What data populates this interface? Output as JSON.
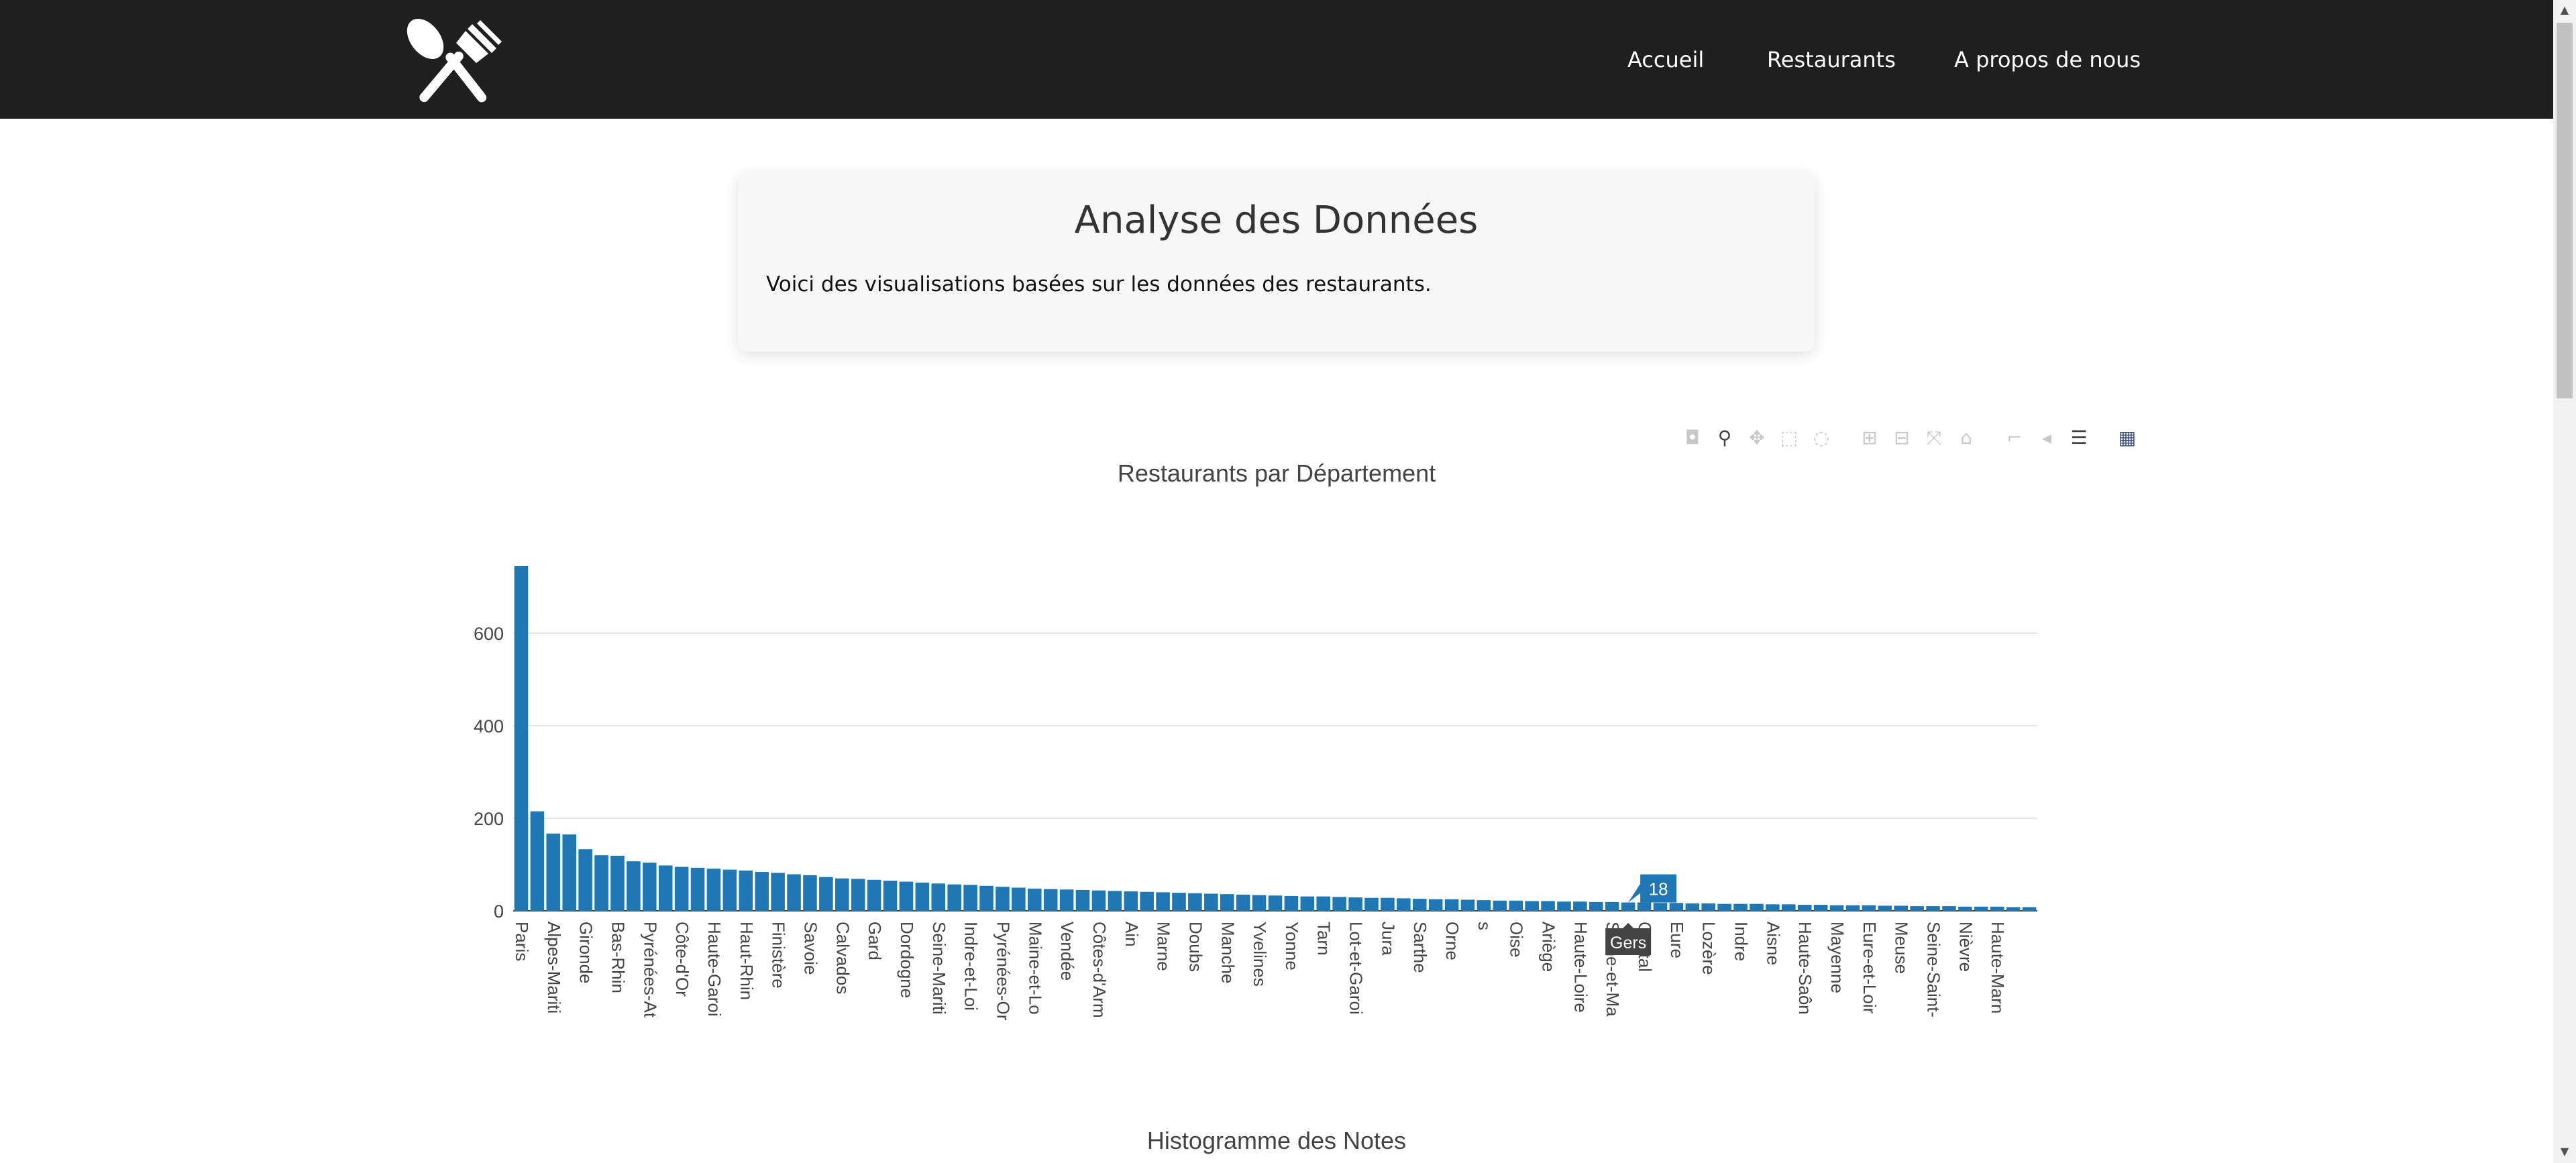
{
  "nav": {
    "logo_icon": "fork-knife-icon",
    "items": [
      "Accueil",
      "Restaurants",
      "A propos de nous"
    ]
  },
  "intro": {
    "title": "Analyse des Données",
    "text": "Voici des visualisations basées sur les données des restaurants."
  },
  "modebar": {
    "icons": [
      "camera-icon",
      "zoom-icon",
      "pan-icon",
      "box-select-icon",
      "lasso-icon",
      "zoom-in-icon",
      "zoom-out-icon",
      "autoscale-icon",
      "reset-axes-icon",
      "spike-lines-icon",
      "hover-closest-icon",
      "hover-compare-icon",
      "plotly-logo-icon"
    ]
  },
  "chart_data": {
    "type": "bar",
    "title": "Restaurants par Département",
    "xlabel": "",
    "ylabel": "",
    "ylim": [
      0,
      760
    ],
    "yticks": [
      0,
      200,
      400,
      600
    ],
    "grid": true,
    "bar_color": "#1f77b4",
    "values": [
      745,
      215,
      167,
      165,
      133,
      120,
      119,
      107,
      104,
      98,
      95,
      93,
      91,
      89,
      87,
      84,
      82,
      79,
      77,
      73,
      70,
      69,
      67,
      65,
      63,
      61,
      59,
      57,
      56,
      54,
      52,
      50,
      48,
      47,
      46,
      45,
      44,
      43,
      42,
      41,
      40,
      39,
      38,
      37,
      36,
      35,
      34,
      33,
      32,
      31,
      31,
      30,
      29,
      28,
      28,
      27,
      26,
      25,
      25,
      24,
      23,
      22,
      22,
      21,
      21,
      20,
      20,
      19,
      19,
      18,
      18,
      17,
      17,
      16,
      16,
      15,
      15,
      15,
      14,
      14,
      13,
      13,
      12,
      12,
      12,
      11,
      11,
      10,
      10,
      10,
      9,
      9,
      9,
      8,
      8
    ],
    "tick_labels": [
      "Paris",
      "Alpes-Mariti",
      "Gironde",
      "Bas-Rhin",
      "Pyrénées-At",
      "Côte-d'Or",
      "Haute-Garoi",
      "Haut-Rhin",
      "Finistère",
      "Savoie",
      "Calvados",
      "Gard",
      "Dordogne",
      "Seine-Mariti",
      "Indre-et-Loi",
      "Pyrénées-Or",
      "Maine-et-Lo",
      "Vendée",
      "Côtes-d'Arm",
      "Ain",
      "Marne",
      "Doubs",
      "Manche",
      "Yvelines",
      "Yonne",
      "Tarn",
      "Lot-et-Garoi",
      "Jura",
      "Sarthe",
      "Orne",
      "s",
      "Oise",
      "Ariège",
      "Haute-Loire",
      "Seine-et-Ma",
      "Cantal",
      "Eure",
      "Lozère",
      "Indre",
      "Aisne",
      "Haute-Saôn",
      "Mayenne",
      "Eure-et-Loir",
      "Meuse",
      "Seine-Saint-",
      "Nièvre",
      "Haute-Marn"
    ],
    "hover": {
      "bar_index": 69,
      "value_label": "18",
      "category_label": "Gers"
    }
  },
  "histogram": {
    "title": "Histogramme des Notes"
  }
}
